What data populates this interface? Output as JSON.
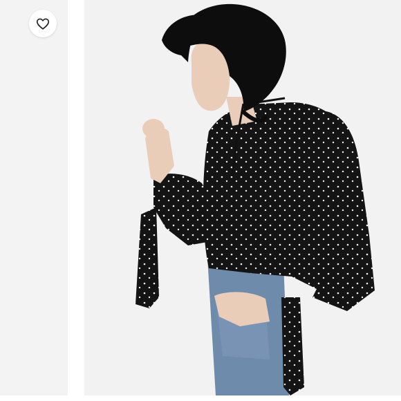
{
  "favorite": {
    "icon": "heart-icon",
    "active": false
  },
  "product_image": {
    "subject": "model-wearing-star-print-wrap-blouse",
    "colors": {
      "background": "#f2f2f2",
      "blouse": "#141414",
      "denim": "#6f8bab",
      "skin": "#e9cdb8",
      "hair": "#0d0d0d"
    }
  }
}
